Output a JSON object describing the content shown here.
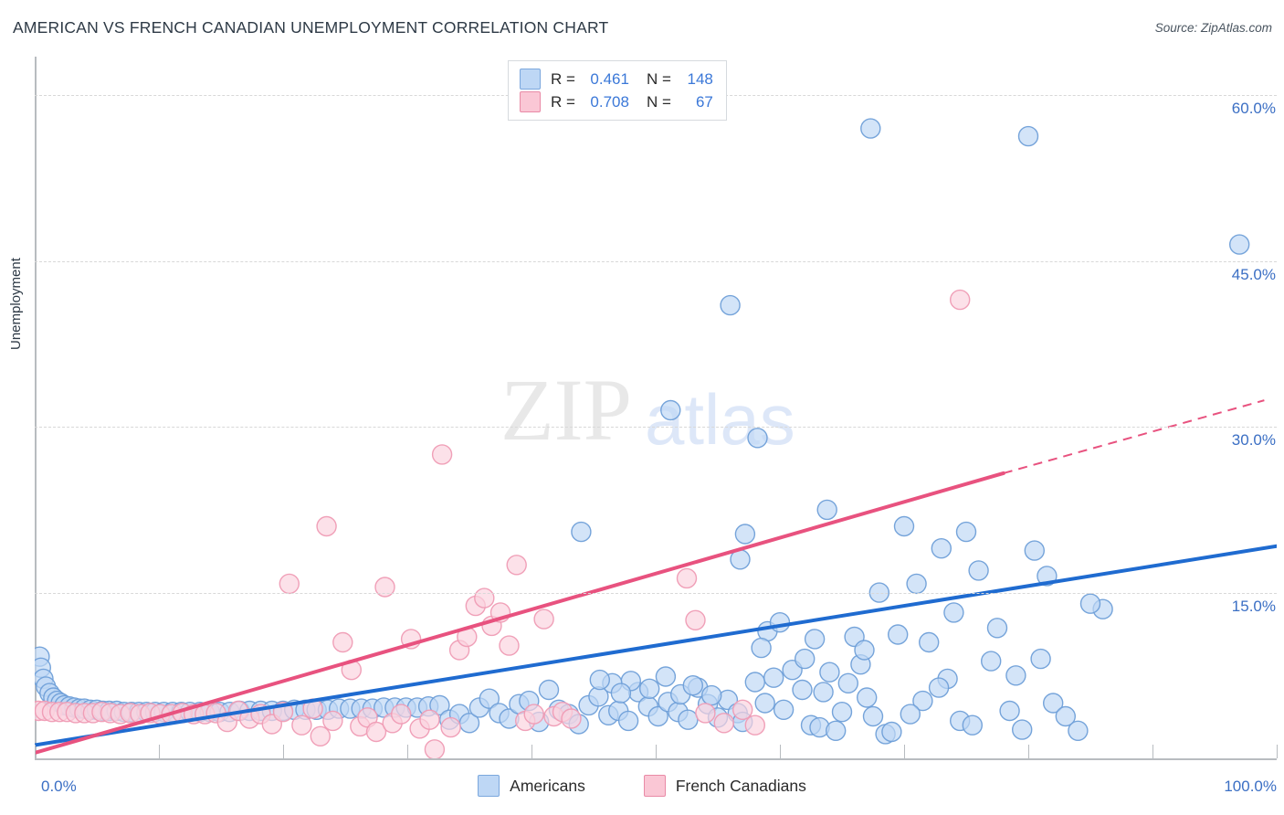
{
  "title": "AMERICAN VS FRENCH CANADIAN UNEMPLOYMENT CORRELATION CHART",
  "source": "Source: ZipAtlas.com",
  "watermark": {
    "part1": "ZIP",
    "part2": "atlas"
  },
  "stats_legend": {
    "rows": [
      {
        "color": "#bed7f5",
        "r_label": "R =",
        "r_value": "0.461",
        "n_label": "N =",
        "n_value": "148"
      },
      {
        "color": "#fac7d5",
        "r_label": "R =",
        "r_value": "0.708",
        "n_label": "N =",
        "n_value": "67"
      }
    ]
  },
  "series_legend": [
    {
      "label": "Americans",
      "color": "#bed7f5",
      "border": "#7ba7dd"
    },
    {
      "label": "French Canadians",
      "color": "#fac7d5",
      "border": "#e98aa6"
    }
  ],
  "axes": {
    "y_title": "Unemployment",
    "x_min_label": "0.0%",
    "x_max_label": "100.0%",
    "y_tick_labels": [
      "60.0%",
      "45.0%",
      "30.0%",
      "15.0%"
    ]
  },
  "colors": {
    "blue_fill": "#bed7f5",
    "blue_stroke": "#6f9fd8",
    "pink_fill": "#fbd3de",
    "pink_stroke": "#ef9bb4",
    "blue_line": "#1f6bd0",
    "pink_line": "#e8527f",
    "grid": "#d8d8d8",
    "axis": "#b8bcc0",
    "tick_text": "#3b6fc4"
  },
  "chart_data": {
    "type": "scatter",
    "title": "AMERICAN VS FRENCH CANADIAN UNEMPLOYMENT CORRELATION CHART",
    "xlabel": "",
    "ylabel": "Unemployment",
    "xlim": [
      0,
      100
    ],
    "ylim": [
      0,
      63.5
    ],
    "x_ticks": [
      0,
      10,
      20,
      30,
      40,
      50,
      60,
      70,
      80,
      90,
      100
    ],
    "y_gridlines": [
      15,
      30,
      45,
      60
    ],
    "grid": true,
    "legend_position": "bottom-center",
    "series": [
      {
        "name": "Americans",
        "color": "#bed7f5",
        "r": 0.461,
        "n": 148,
        "trendline": {
          "x0": 0,
          "y0": 1.2,
          "x1": 100,
          "y1": 19.2,
          "style": "solid",
          "color": "#1f6bd0"
        },
        "points": [
          [
            0.4,
            9.2
          ],
          [
            0.5,
            8.2
          ],
          [
            0.7,
            7.2
          ],
          [
            0.9,
            6.5
          ],
          [
            1.2,
            5.9
          ],
          [
            1.5,
            5.5
          ],
          [
            1.8,
            5.2
          ],
          [
            2.1,
            5.0
          ],
          [
            2.4,
            4.8
          ],
          [
            2.8,
            4.7
          ],
          [
            3.2,
            4.6
          ],
          [
            3.6,
            4.5
          ],
          [
            4.0,
            4.5
          ],
          [
            4.5,
            4.4
          ],
          [
            5.0,
            4.4
          ],
          [
            5.5,
            4.3
          ],
          [
            6.0,
            4.3
          ],
          [
            6.6,
            4.3
          ],
          [
            7.2,
            4.2
          ],
          [
            7.8,
            4.2
          ],
          [
            8.4,
            4.2
          ],
          [
            9.0,
            4.2
          ],
          [
            9.7,
            4.2
          ],
          [
            10.4,
            4.2
          ],
          [
            11.1,
            4.2
          ],
          [
            11.8,
            4.2
          ],
          [
            12.5,
            4.2
          ],
          [
            13.3,
            4.2
          ],
          [
            14.1,
            4.2
          ],
          [
            14.9,
            4.2
          ],
          [
            15.7,
            4.2
          ],
          [
            16.5,
            4.3
          ],
          [
            17.3,
            4.3
          ],
          [
            18.2,
            4.3
          ],
          [
            19.1,
            4.3
          ],
          [
            20.0,
            4.3
          ],
          [
            20.9,
            4.4
          ],
          [
            21.8,
            4.4
          ],
          [
            22.7,
            4.4
          ],
          [
            23.6,
            4.4
          ],
          [
            24.5,
            4.5
          ],
          [
            25.4,
            4.5
          ],
          [
            26.3,
            4.5
          ],
          [
            27.2,
            4.5
          ],
          [
            28.1,
            4.6
          ],
          [
            29.0,
            4.6
          ],
          [
            29.9,
            4.6
          ],
          [
            30.8,
            4.6
          ],
          [
            31.7,
            4.7
          ],
          [
            32.6,
            4.8
          ],
          [
            33.4,
            3.5
          ],
          [
            34.2,
            4.0
          ],
          [
            35.0,
            3.2
          ],
          [
            35.8,
            4.6
          ],
          [
            36.6,
            5.4
          ],
          [
            37.4,
            4.1
          ],
          [
            38.2,
            3.6
          ],
          [
            39.0,
            4.9
          ],
          [
            39.8,
            5.2
          ],
          [
            40.6,
            3.3
          ],
          [
            41.4,
            6.2
          ],
          [
            42.2,
            4.4
          ],
          [
            43.0,
            4.0
          ],
          [
            43.8,
            3.1
          ],
          [
            44.6,
            4.8
          ],
          [
            45.4,
            5.6
          ],
          [
            46.2,
            3.9
          ],
          [
            47.0,
            4.3
          ],
          [
            47.8,
            3.4
          ],
          [
            48.6,
            6.0
          ],
          [
            49.4,
            4.7
          ],
          [
            50.2,
            3.8
          ],
          [
            51.0,
            5.1
          ],
          [
            51.8,
            4.2
          ],
          [
            52.6,
            3.5
          ],
          [
            53.4,
            6.4
          ],
          [
            54.2,
            4.9
          ],
          [
            55.0,
            3.7
          ],
          [
            55.8,
            5.3
          ],
          [
            56.6,
            4.1
          ],
          [
            44.0,
            20.5
          ],
          [
            48.0,
            7.0
          ],
          [
            49.5,
            6.3
          ],
          [
            50.8,
            7.4
          ],
          [
            52.0,
            5.8
          ],
          [
            46.5,
            6.8
          ],
          [
            47.2,
            5.9
          ],
          [
            45.5,
            7.1
          ],
          [
            53.0,
            6.6
          ],
          [
            54.5,
            5.7
          ],
          [
            57.0,
            3.3
          ],
          [
            58.0,
            6.9
          ],
          [
            58.8,
            5.0
          ],
          [
            59.5,
            7.3
          ],
          [
            60.3,
            4.4
          ],
          [
            61.0,
            8.0
          ],
          [
            61.8,
            6.2
          ],
          [
            62.5,
            3.0
          ],
          [
            63.2,
            2.8
          ],
          [
            64.0,
            7.8
          ],
          [
            51.2,
            31.5
          ],
          [
            56.0,
            41.0
          ],
          [
            58.2,
            29.0
          ],
          [
            57.2,
            20.3
          ],
          [
            56.8,
            18.0
          ],
          [
            59.0,
            11.5
          ],
          [
            60.0,
            12.3
          ],
          [
            58.5,
            10.0
          ],
          [
            62.0,
            9.0
          ],
          [
            63.5,
            6.0
          ],
          [
            64.5,
            2.5
          ],
          [
            65.5,
            6.8
          ],
          [
            66.5,
            8.5
          ],
          [
            67.5,
            3.8
          ],
          [
            68.0,
            15.0
          ],
          [
            63.8,
            22.5
          ],
          [
            66.0,
            11.0
          ],
          [
            67.0,
            5.5
          ],
          [
            68.5,
            2.2
          ],
          [
            69.0,
            2.4
          ],
          [
            70.0,
            21.0
          ],
          [
            71.0,
            15.8
          ],
          [
            72.0,
            10.5
          ],
          [
            73.5,
            7.2
          ],
          [
            74.5,
            3.4
          ],
          [
            67.3,
            57.0
          ],
          [
            80.0,
            56.3
          ],
          [
            97.0,
            46.5
          ],
          [
            75.0,
            20.5
          ],
          [
            76.0,
            17.0
          ],
          [
            77.5,
            11.8
          ],
          [
            78.5,
            4.3
          ],
          [
            79.5,
            2.6
          ],
          [
            74.0,
            13.2
          ],
          [
            75.5,
            3.0
          ],
          [
            71.5,
            5.2
          ],
          [
            72.8,
            6.4
          ],
          [
            73.0,
            19.0
          ],
          [
            80.5,
            18.8
          ],
          [
            81.5,
            16.5
          ],
          [
            82.0,
            5.0
          ],
          [
            84.0,
            2.5
          ],
          [
            86.0,
            13.5
          ],
          [
            83.0,
            3.8
          ],
          [
            85.0,
            14.0
          ],
          [
            81.0,
            9.0
          ],
          [
            79.0,
            7.5
          ],
          [
            77.0,
            8.8
          ],
          [
            69.5,
            11.2
          ],
          [
            70.5,
            4.0
          ],
          [
            66.8,
            9.8
          ],
          [
            65.0,
            4.2
          ],
          [
            62.8,
            10.8
          ]
        ]
      },
      {
        "name": "French Canadians",
        "color": "#fbd3de",
        "r": 0.708,
        "n": 67,
        "trendline": {
          "x0": 0,
          "y0": 0.5,
          "x1": 78,
          "y1": 25.8,
          "style": "solid",
          "color": "#e8527f"
        },
        "trendline_extension": {
          "x0": 78,
          "y0": 25.8,
          "x1": 99,
          "y1": 32.4,
          "style": "dashed",
          "color": "#e8527f"
        },
        "points": [
          [
            0.3,
            4.3
          ],
          [
            0.8,
            4.3
          ],
          [
            1.4,
            4.2
          ],
          [
            2.0,
            4.2
          ],
          [
            2.6,
            4.2
          ],
          [
            3.3,
            4.1
          ],
          [
            4.0,
            4.1
          ],
          [
            4.7,
            4.1
          ],
          [
            5.4,
            4.2
          ],
          [
            6.1,
            4.1
          ],
          [
            6.9,
            4.0
          ],
          [
            7.7,
            4.1
          ],
          [
            8.5,
            4.0
          ],
          [
            9.3,
            4.1
          ],
          [
            10.1,
            4.0
          ],
          [
            11.0,
            4.0
          ],
          [
            11.9,
            4.1
          ],
          [
            12.8,
            4.0
          ],
          [
            13.7,
            4.0
          ],
          [
            14.6,
            4.1
          ],
          [
            15.5,
            3.3
          ],
          [
            16.4,
            4.3
          ],
          [
            17.3,
            3.6
          ],
          [
            18.2,
            4.0
          ],
          [
            19.1,
            3.1
          ],
          [
            20.0,
            4.2
          ],
          [
            20.5,
            15.8
          ],
          [
            21.5,
            3.0
          ],
          [
            22.4,
            4.5
          ],
          [
            23.0,
            2.0
          ],
          [
            23.5,
            21.0
          ],
          [
            24.0,
            3.4
          ],
          [
            24.8,
            10.5
          ],
          [
            25.5,
            8.0
          ],
          [
            26.2,
            2.9
          ],
          [
            26.8,
            3.7
          ],
          [
            27.5,
            2.4
          ],
          [
            28.2,
            15.5
          ],
          [
            28.8,
            3.2
          ],
          [
            29.5,
            4.0
          ],
          [
            30.3,
            10.8
          ],
          [
            31.0,
            2.7
          ],
          [
            31.8,
            3.5
          ],
          [
            32.2,
            0.8
          ],
          [
            32.8,
            27.5
          ],
          [
            33.5,
            2.8
          ],
          [
            34.2,
            9.8
          ],
          [
            34.8,
            11.0
          ],
          [
            35.5,
            13.8
          ],
          [
            36.2,
            14.5
          ],
          [
            36.8,
            12.0
          ],
          [
            37.5,
            13.2
          ],
          [
            38.2,
            10.2
          ],
          [
            38.8,
            17.5
          ],
          [
            39.5,
            3.4
          ],
          [
            40.2,
            4.0
          ],
          [
            41.0,
            12.6
          ],
          [
            41.8,
            3.8
          ],
          [
            42.5,
            4.2
          ],
          [
            43.2,
            3.6
          ],
          [
            52.5,
            16.3
          ],
          [
            53.2,
            12.5
          ],
          [
            54.0,
            4.1
          ],
          [
            55.5,
            3.2
          ],
          [
            57.0,
            4.4
          ],
          [
            74.5,
            41.5
          ],
          [
            58.0,
            3.0
          ]
        ]
      }
    ]
  }
}
